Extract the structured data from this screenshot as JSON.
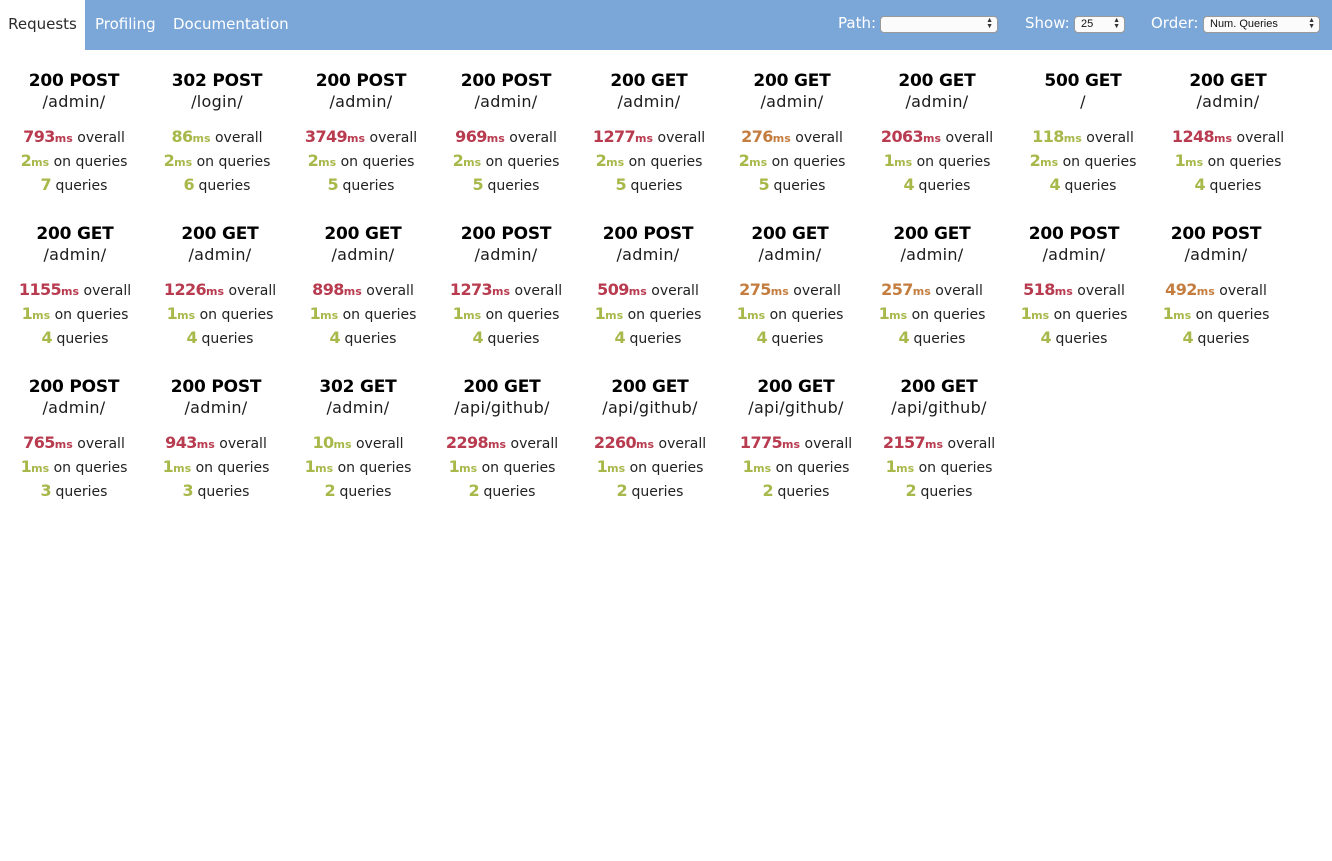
{
  "nav": {
    "tabs": [
      "Requests",
      "Profiling",
      "Documentation"
    ],
    "path_label": "Path:",
    "path_value": "",
    "show_label": "Show:",
    "show_value": "25",
    "order_label": "Order:",
    "order_value": "Num. Queries"
  },
  "labels": {
    "unit": "ms",
    "overall": "overall",
    "on_queries": "on queries",
    "queries": "queries"
  },
  "colors": {
    "topbar": "#7ba7d8",
    "slow": "#b83b4f",
    "medium": "#c47d3f",
    "fast": "#a8b84a"
  },
  "requests": [
    {
      "status": "200 POST",
      "path": "/admin/",
      "overall": "793",
      "overall_color": "slow",
      "query_time": "2",
      "num_queries": "7"
    },
    {
      "status": "302 POST",
      "path": "/login/",
      "overall": "86",
      "overall_color": "fast",
      "query_time": "2",
      "num_queries": "6"
    },
    {
      "status": "200 POST",
      "path": "/admin/",
      "overall": "3749",
      "overall_color": "slow",
      "query_time": "2",
      "num_queries": "5"
    },
    {
      "status": "200 POST",
      "path": "/admin/",
      "overall": "969",
      "overall_color": "slow",
      "query_time": "2",
      "num_queries": "5"
    },
    {
      "status": "200 GET",
      "path": "/admin/",
      "overall": "1277",
      "overall_color": "slow",
      "query_time": "2",
      "num_queries": "5"
    },
    {
      "status": "200 GET",
      "path": "/admin/",
      "overall": "276",
      "overall_color": "medium",
      "query_time": "2",
      "num_queries": "5"
    },
    {
      "status": "200 GET",
      "path": "/admin/",
      "overall": "2063",
      "overall_color": "slow",
      "query_time": "1",
      "num_queries": "4"
    },
    {
      "status": "500 GET",
      "path": "/",
      "overall": "118",
      "overall_color": "fast",
      "query_time": "2",
      "num_queries": "4"
    },
    {
      "status": "200 GET",
      "path": "/admin/",
      "overall": "1248",
      "overall_color": "slow",
      "query_time": "1",
      "num_queries": "4"
    },
    {
      "status": "200 GET",
      "path": "/admin/",
      "overall": "1155",
      "overall_color": "slow",
      "query_time": "1",
      "num_queries": "4"
    },
    {
      "status": "200 GET",
      "path": "/admin/",
      "overall": "1226",
      "overall_color": "slow",
      "query_time": "1",
      "num_queries": "4"
    },
    {
      "status": "200 GET",
      "path": "/admin/",
      "overall": "898",
      "overall_color": "slow",
      "query_time": "1",
      "num_queries": "4"
    },
    {
      "status": "200 POST",
      "path": "/admin/",
      "overall": "1273",
      "overall_color": "slow",
      "query_time": "1",
      "num_queries": "4"
    },
    {
      "status": "200 POST",
      "path": "/admin/",
      "overall": "509",
      "overall_color": "slow",
      "query_time": "1",
      "num_queries": "4"
    },
    {
      "status": "200 GET",
      "path": "/admin/",
      "overall": "275",
      "overall_color": "medium",
      "query_time": "1",
      "num_queries": "4"
    },
    {
      "status": "200 GET",
      "path": "/admin/",
      "overall": "257",
      "overall_color": "medium",
      "query_time": "1",
      "num_queries": "4"
    },
    {
      "status": "200 POST",
      "path": "/admin/",
      "overall": "518",
      "overall_color": "slow",
      "query_time": "1",
      "num_queries": "4"
    },
    {
      "status": "200 POST",
      "path": "/admin/",
      "overall": "492",
      "overall_color": "medium",
      "query_time": "1",
      "num_queries": "4"
    },
    {
      "status": "200 POST",
      "path": "/admin/",
      "overall": "765",
      "overall_color": "slow",
      "query_time": "1",
      "num_queries": "3"
    },
    {
      "status": "200 POST",
      "path": "/admin/",
      "overall": "943",
      "overall_color": "slow",
      "query_time": "1",
      "num_queries": "3"
    },
    {
      "status": "302 GET",
      "path": "/admin/",
      "overall": "10",
      "overall_color": "fast",
      "query_time": "1",
      "num_queries": "2"
    },
    {
      "status": "200 GET",
      "path": "/api/github/",
      "overall": "2298",
      "overall_color": "slow",
      "query_time": "1",
      "num_queries": "2"
    },
    {
      "status": "200 GET",
      "path": "/api/github/",
      "overall": "2260",
      "overall_color": "slow",
      "query_time": "1",
      "num_queries": "2"
    },
    {
      "status": "200 GET",
      "path": "/api/github/",
      "overall": "1775",
      "overall_color": "slow",
      "query_time": "1",
      "num_queries": "2"
    },
    {
      "status": "200 GET",
      "path": "/api/github/",
      "overall": "2157",
      "overall_color": "slow",
      "query_time": "1",
      "num_queries": "2"
    }
  ]
}
